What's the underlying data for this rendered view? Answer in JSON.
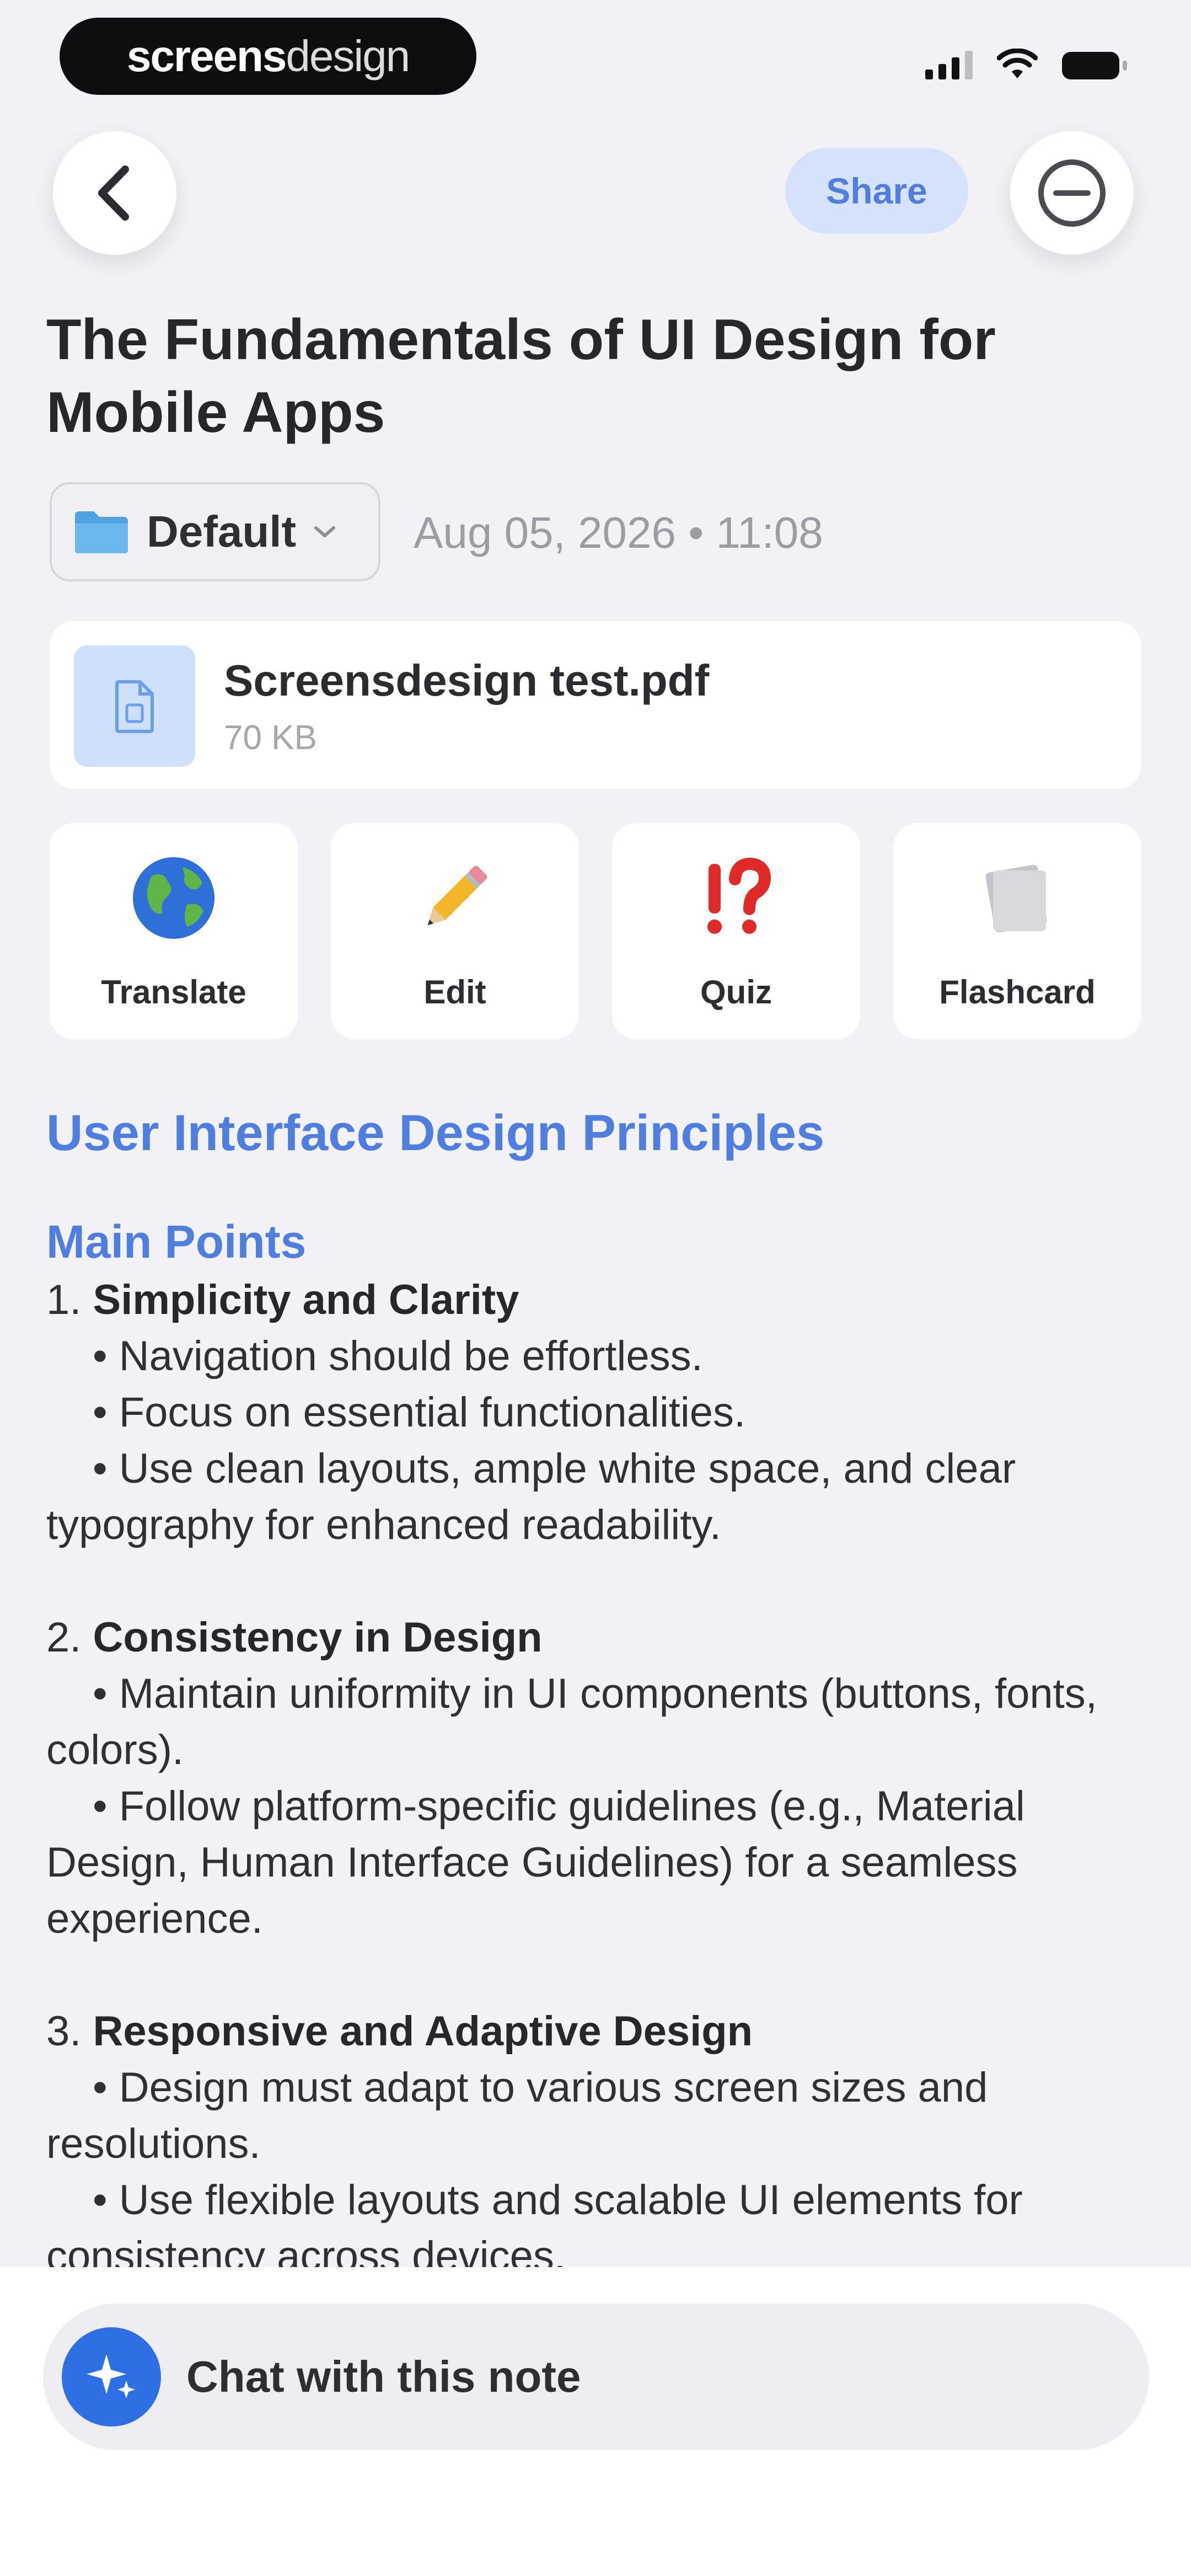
{
  "status_bar": {
    "brand_bold": "screens",
    "brand_light": "design"
  },
  "nav": {
    "share_label": "Share",
    "back_icon": "chevron-left-icon",
    "more_icon": "ellipsis-circle-icon"
  },
  "note": {
    "title": "The Fundamentals of UI Design for Mobile Apps",
    "folder_label": "Default",
    "date": "Aug 05, 2026 • 11:08"
  },
  "file": {
    "name": "Screensdesign test.pdf",
    "size": "70 KB"
  },
  "tools": [
    {
      "label": "Translate",
      "icon": "globe-icon"
    },
    {
      "label": "Edit",
      "icon": "pencil-icon"
    },
    {
      "label": "Quiz",
      "icon": "exclamation-question-icon"
    },
    {
      "label": "Flashcard",
      "icon": "flashcard-icon"
    }
  ],
  "content": {
    "heading": "User Interface Design Principles",
    "subheading": "Main Points",
    "sections": [
      {
        "number": "1.",
        "title": "Simplicity and Clarity",
        "bullets": [
          "• Navigation should be effortless.",
          "• Focus on essential functionalities.",
          "• Use clean layouts, ample white space, and clear typography for enhanced readability."
        ]
      },
      {
        "number": "2.",
        "title": "Consistency in Design",
        "bullets": [
          "• Maintain uniformity in UI components (buttons, fonts, colors).",
          "• Follow platform-specific guidelines (e.g., Material Design, Human Interface Guidelines) for a seamless experience."
        ]
      },
      {
        "number": "3.",
        "title": "Responsive and Adaptive Design",
        "bullets": [
          "• Design must adapt to various screen sizes and resolutions.",
          "• Use flexible layouts and scalable UI elements for consistency across devices."
        ]
      }
    ]
  },
  "chat": {
    "label": "Chat with this note"
  },
  "colors": {
    "accent": "#4f7ee0",
    "chat_button": "#2f6fe4",
    "share_bg": "#d6e2fb"
  }
}
